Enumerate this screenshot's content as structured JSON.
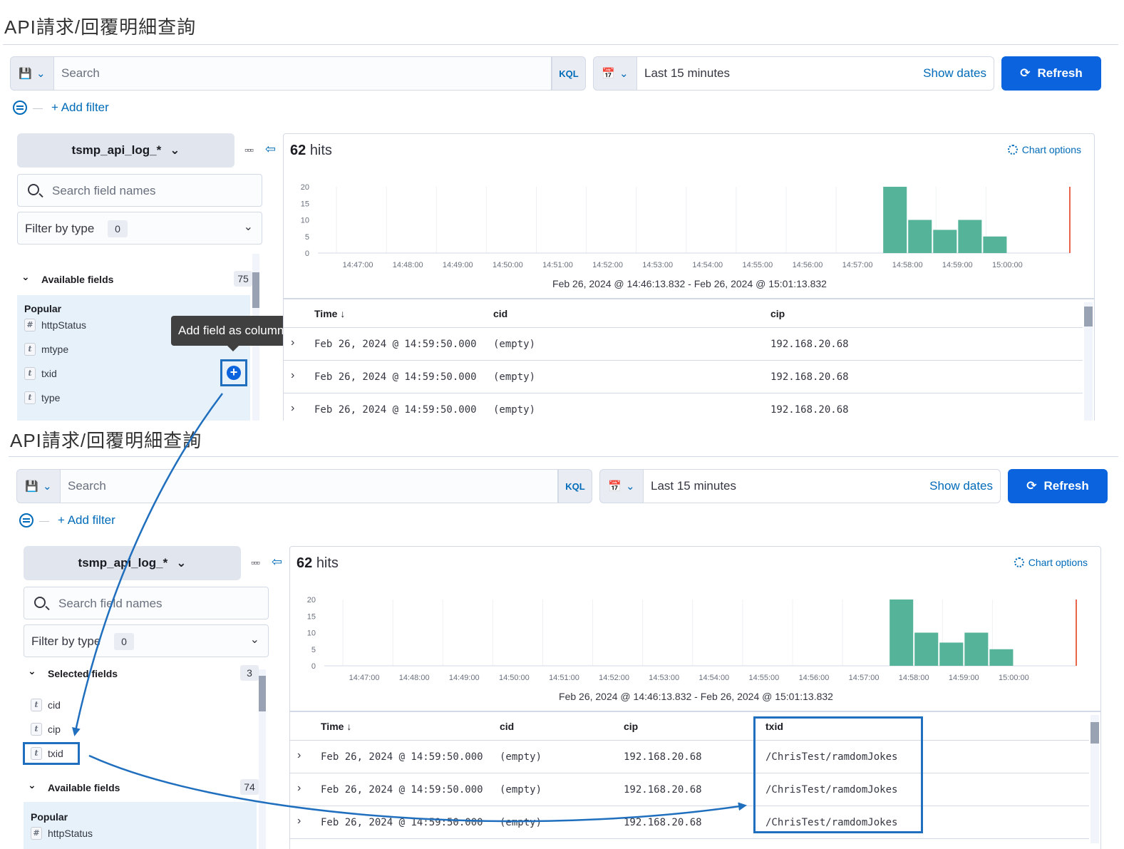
{
  "page": {
    "title": "API請求/回覆明細查詢",
    "search_placeholder": "Search",
    "kql_label": "KQL",
    "time_range": "Last 15 minutes",
    "show_dates": "Show dates",
    "refresh_label": "Refresh",
    "add_filter": "+ Add filter",
    "index_pattern": "tsmp_api_log_*",
    "field_search_placeholder": "Search field names",
    "filter_by_type": "Filter by type",
    "filter_count": "0",
    "hits_count": "62",
    "hits_label": "hits",
    "chart_options": "Chart options",
    "date_range_label": "Feb 26, 2024 @ 14:46:13.832 - Feb 26, 2024 @ 15:01:13.832"
  },
  "top": {
    "available_label": "Available fields",
    "available_count": "75",
    "popular_label": "Popular",
    "fields": [
      {
        "type": "#",
        "name": "httpStatus"
      },
      {
        "type": "t",
        "name": "mtype"
      },
      {
        "type": "t",
        "name": "txid"
      },
      {
        "type": "t",
        "name": "type"
      }
    ],
    "tooltip": "Add field as column",
    "columns": [
      "Time ↓",
      "cid",
      "cip"
    ],
    "rows": [
      [
        "Feb 26, 2024 @ 14:59:50.000",
        "(empty)",
        "192.168.20.68"
      ],
      [
        "Feb 26, 2024 @ 14:59:50.000",
        "(empty)",
        "192.168.20.68"
      ],
      [
        "Feb 26, 2024 @ 14:59:50.000",
        "(empty)",
        "192.168.20.68"
      ]
    ]
  },
  "bottom": {
    "selected_label": "Selected fields",
    "selected_count": "3",
    "selected_fields": [
      {
        "type": "t",
        "name": "cid"
      },
      {
        "type": "t",
        "name": "cip"
      },
      {
        "type": "t",
        "name": "txid"
      }
    ],
    "available_label": "Available fields",
    "available_count": "74",
    "popular_label": "Popular",
    "popular_fields": [
      {
        "type": "#",
        "name": "httpStatus"
      }
    ],
    "columns": [
      "Time ↓",
      "cid",
      "cip",
      "txid"
    ],
    "rows": [
      [
        "Feb 26, 2024 @ 14:59:50.000",
        "(empty)",
        "192.168.20.68",
        "/ChrisTest/ramdomJokes"
      ],
      [
        "Feb 26, 2024 @ 14:59:50.000",
        "(empty)",
        "192.168.20.68",
        "/ChrisTest/ramdomJokes"
      ],
      [
        "Feb 26, 2024 @ 14:59:50.000",
        "(empty)",
        "192.168.20.68",
        "/ChrisTest/ramdomJokes"
      ]
    ]
  },
  "chart_data": {
    "type": "bar",
    "categories": [
      "14:47:00",
      "14:48:00",
      "14:49:00",
      "14:50:00",
      "14:51:00",
      "14:52:00",
      "14:53:00",
      "14:54:00",
      "14:55:00",
      "14:56:00",
      "14:57:00",
      "14:58:00",
      "14:58:30",
      "14:59:00",
      "14:59:30",
      "15:00:00"
    ],
    "x_ticks": [
      "14:47:00",
      "14:48:00",
      "14:49:00",
      "14:50:00",
      "14:51:00",
      "14:52:00",
      "14:53:00",
      "14:54:00",
      "14:55:00",
      "14:56:00",
      "14:57:00",
      "14:58:00",
      "14:59:00",
      "15:00:00"
    ],
    "bar_starts": [
      "14:58:00",
      "14:58:30",
      "14:59:00",
      "14:59:30",
      "15:00:00"
    ],
    "values": [
      20,
      10,
      7,
      10,
      5
    ],
    "y_ticks": [
      0,
      5,
      10,
      15,
      20
    ],
    "ylim": [
      0,
      20
    ],
    "bar_color": "#54b399",
    "now_marker_color": "#e7664c"
  },
  "colors": {
    "accent": "#006bb8",
    "primary_button": "#0b64dd",
    "annotation": "#1f6fbe"
  }
}
